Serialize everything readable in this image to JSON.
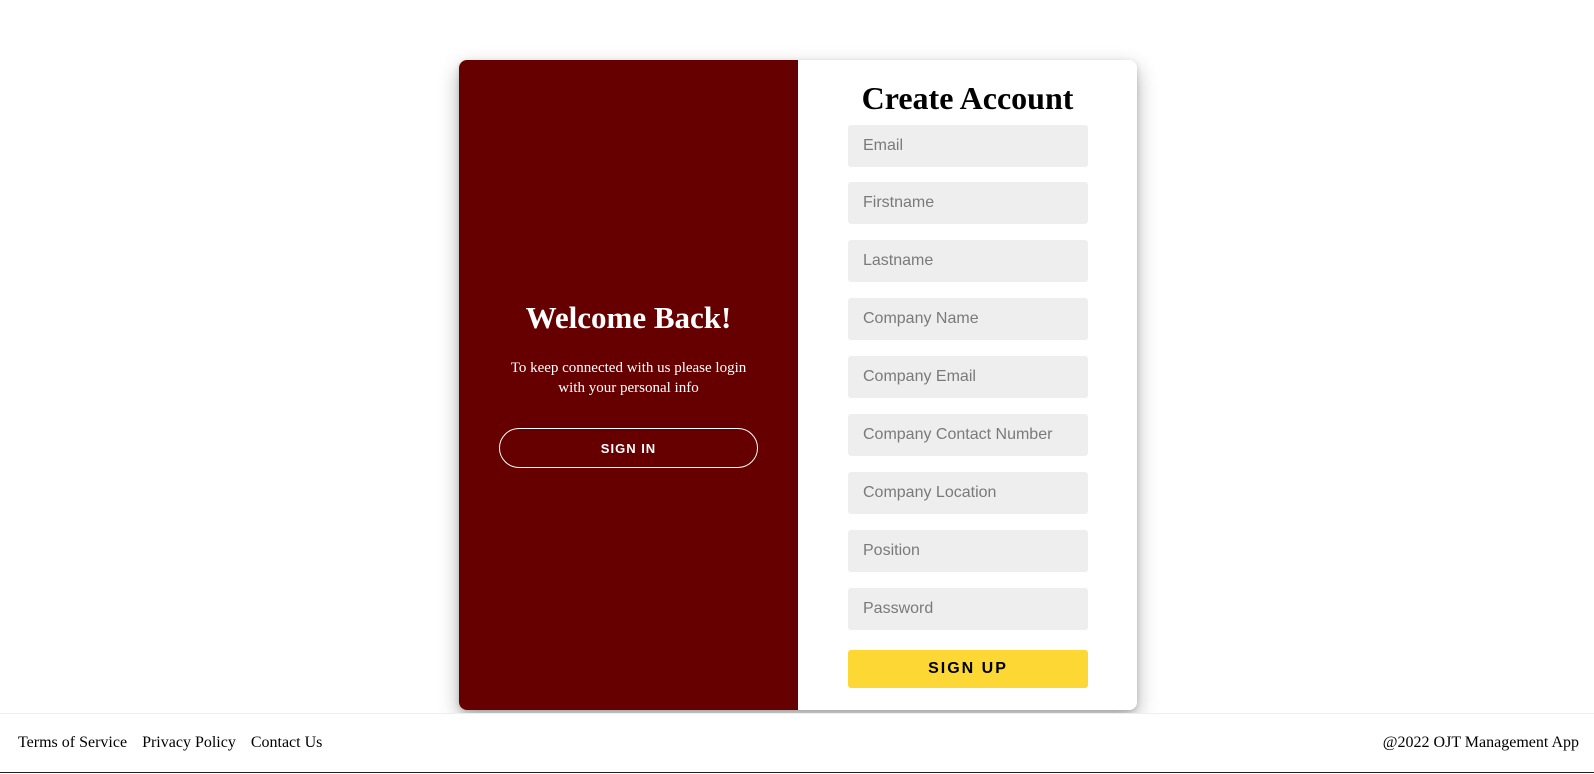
{
  "colors": {
    "left_panel_bg": "#660000",
    "signup_button_bg": "#fdd835",
    "input_bg": "#eeeeee"
  },
  "welcome": {
    "title": "Welcome Back!",
    "text": "To keep connected with us please login with your personal info",
    "signin_label": "SIGN IN"
  },
  "form": {
    "title": "Create Account",
    "fields": {
      "email": {
        "placeholder": "Email",
        "value": ""
      },
      "firstname": {
        "placeholder": "Firstname",
        "value": ""
      },
      "lastname": {
        "placeholder": "Lastname",
        "value": ""
      },
      "company_name": {
        "placeholder": "Company Name",
        "value": ""
      },
      "company_email": {
        "placeholder": "Company Email",
        "value": ""
      },
      "company_contact": {
        "placeholder": "Company Contact Number",
        "value": ""
      },
      "company_location": {
        "placeholder": "Company Location",
        "value": ""
      },
      "position": {
        "placeholder": "Position",
        "value": ""
      },
      "password": {
        "placeholder": "Password",
        "value": ""
      }
    },
    "signup_label": "SIGN UP"
  },
  "footer": {
    "links": {
      "terms": "Terms of Service",
      "privacy": "Privacy Policy",
      "contact": "Contact Us"
    },
    "copyright": "@2022 OJT Management App"
  }
}
